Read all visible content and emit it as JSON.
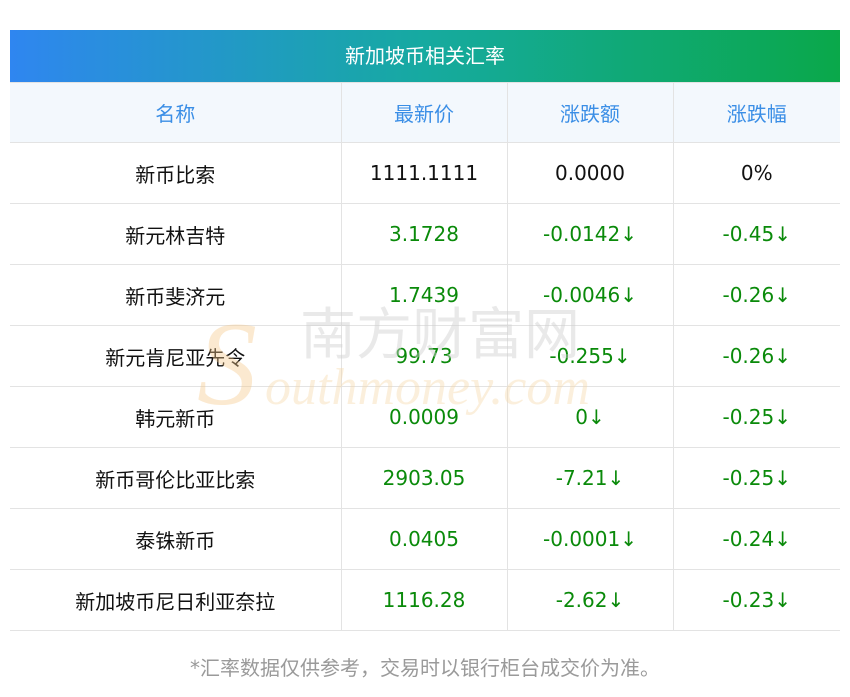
{
  "title": "新加坡币相关汇率",
  "columns": [
    "名称",
    "最新价",
    "涨跌额",
    "涨跌幅"
  ],
  "rows": [
    {
      "name": "新币比索",
      "price": "1111.1111",
      "change": "0.0000",
      "pct": "0%",
      "color": "#111111"
    },
    {
      "name": "新元林吉特",
      "price": "3.1728",
      "change": "-0.0142↓",
      "pct": "-0.45↓",
      "color": "#0a8a0a"
    },
    {
      "name": "新币斐济元",
      "price": "1.7439",
      "change": "-0.0046↓",
      "pct": "-0.26↓",
      "color": "#0a8a0a"
    },
    {
      "name": "新元肯尼亚先令",
      "price": "99.73",
      "change": "-0.255↓",
      "pct": "-0.26↓",
      "color": "#0a8a0a"
    },
    {
      "name": "韩元新币",
      "price": "0.0009",
      "change": "0↓",
      "pct": "-0.25↓",
      "color": "#0a8a0a"
    },
    {
      "name": "新币哥伦比亚比索",
      "price": "2903.05",
      "change": "-7.21↓",
      "pct": "-0.25↓",
      "color": "#0a8a0a"
    },
    {
      "name": "泰铢新币",
      "price": "0.0405",
      "change": "-0.0001↓",
      "pct": "-0.24↓",
      "color": "#0a8a0a"
    },
    {
      "name": "新加坡币尼日利亚奈拉",
      "price": "1116.28",
      "change": "-2.62↓",
      "pct": "-0.23↓",
      "color": "#0a8a0a"
    }
  ],
  "footnote": "*汇率数据仅供参考，交易时以银行柜台成交价为准。",
  "watermark": {
    "cn": "南方财富网",
    "en": "outhmoney.com",
    "s": "S"
  }
}
